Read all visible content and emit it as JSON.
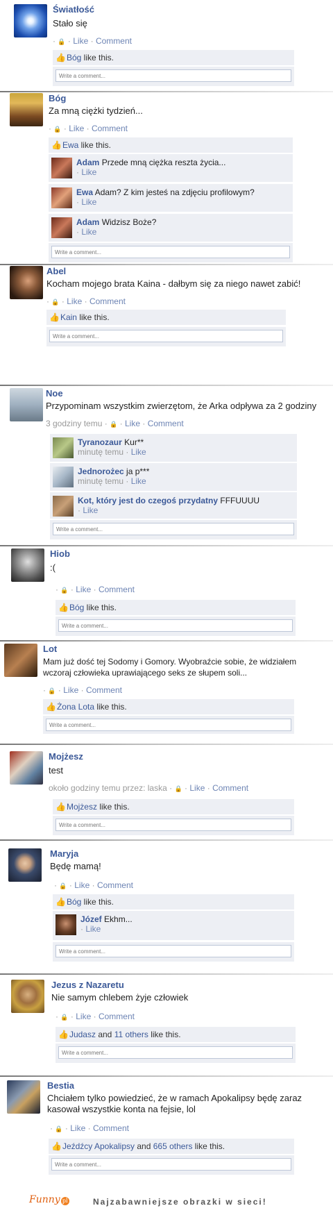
{
  "ui": {
    "like": "Like",
    "comment": "Comment",
    "dot": "·",
    "lock": "🔒",
    "write_placeholder": "Write a comment...",
    "like_this": "like this."
  },
  "posts": [
    {
      "name": "Światłość",
      "text": "Stało się",
      "meta_prefix": "",
      "likers": "Bóg",
      "likers_extra": "",
      "comments": []
    },
    {
      "name": "Bóg",
      "text": "Za mną ciężki tydzień...",
      "meta_prefix": "",
      "likers": "Ewa",
      "likers_extra": "",
      "comments": [
        {
          "name": "Adam",
          "text": "Przede mną ciężka reszta życia...",
          "time": ""
        },
        {
          "name": "Ewa",
          "text": "Adam? Z kim jesteś na zdjęciu profilowym?",
          "time": ""
        },
        {
          "name": "Adam",
          "text": "Widzisz Boże?",
          "time": ""
        }
      ]
    },
    {
      "name": "Abel",
      "text": "Kocham mojego brata Kaina - dałbym się za niego nawet zabić!",
      "meta_prefix": "",
      "likers": "Kain",
      "likers_extra": "",
      "comments": []
    },
    {
      "name": "Noe",
      "text": "Przypominam wszystkim zwierzętom, że Arka odpływa za 2 godziny",
      "meta_prefix": "3 godziny temu",
      "likers": "",
      "likers_extra": "",
      "comments": [
        {
          "name": "Tyranozaur",
          "text": "Kur**",
          "time": "minutę temu"
        },
        {
          "name": "Jednorożec",
          "text": "ja p***",
          "time": "minutę temu"
        },
        {
          "name": "Kot, który jest do czegoś przydatny",
          "text": "FFFUUUU",
          "time": ""
        }
      ]
    },
    {
      "name": "Hiob",
      "text": ":(",
      "meta_prefix": "",
      "likers": "Bóg",
      "likers_extra": "",
      "comments": []
    },
    {
      "name": "Lot",
      "text": "Mam już dość tej Sodomy i Gomory. Wyobraźcie sobie, że widziałem",
      "text2": "wczoraj człowieka uprawiającego seks ze słupem soli...",
      "meta_prefix": "",
      "likers": "Żona Lota",
      "likers_extra": "",
      "comments": []
    },
    {
      "name": "Mojżesz",
      "text": "test",
      "meta_prefix": "około godziny temu przez: laska",
      "likers": "Mojżesz",
      "likers_extra": "",
      "comments": []
    },
    {
      "name": "Maryja",
      "text": "Będę mamą!",
      "meta_prefix": "",
      "likers": "Bóg",
      "likers_extra": "",
      "comments": [
        {
          "name": "Józef",
          "text": "Ekhm...",
          "time": ""
        }
      ]
    },
    {
      "name": "Jezus z Nazaretu",
      "text": "Nie samym chlebem żyje człowiek",
      "meta_prefix": "",
      "likers": "Judasz",
      "likers_extra": "11 others",
      "comments": []
    },
    {
      "name": "Bestia",
      "text": "Chciałem tylko powiedzieć, że w ramach Apokalipsy będę zaraz",
      "text2": "kasował wszystkie konta na fejsie, lol",
      "meta_prefix": "",
      "likers": "Jeźdźcy Apokalipsy",
      "likers_extra": "665 others",
      "comments": []
    }
  ],
  "and": "and",
  "footer": {
    "logo": "Funny",
    "logo_badge": "pl",
    "tagline": "Najzabawniejsze obrazki w sieci!"
  },
  "colors": {
    "link": "#3b5998",
    "light_link": "#6d84b4",
    "bg_box": "#edeff4",
    "meta": "#999999"
  }
}
